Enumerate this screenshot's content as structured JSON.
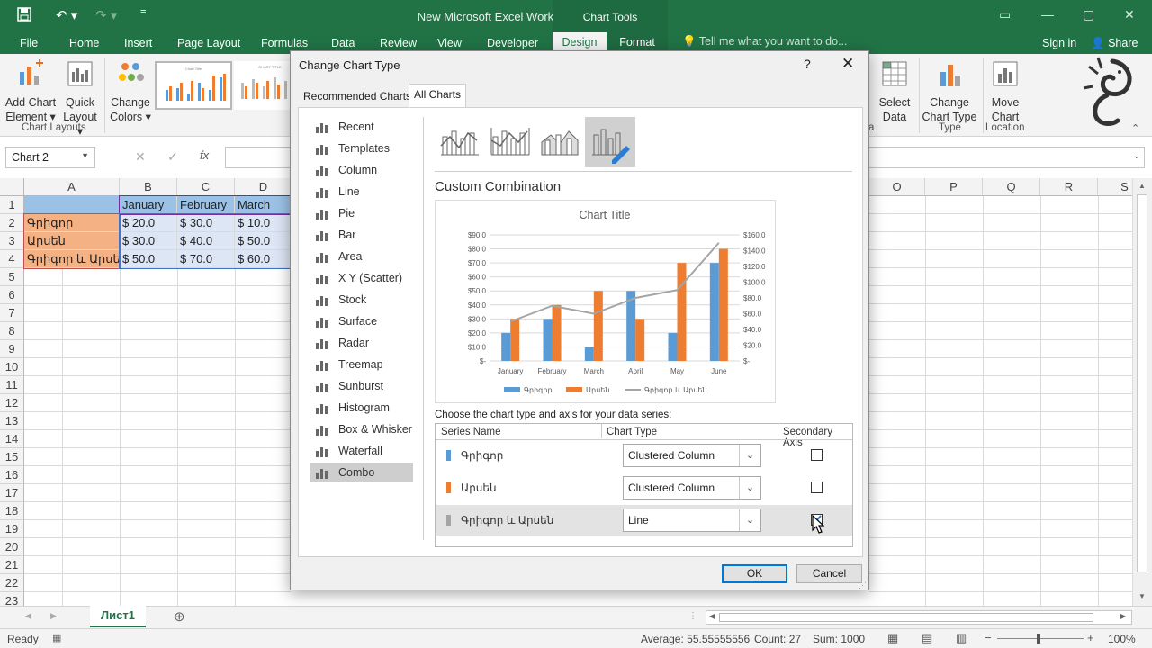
{
  "titlebar": {
    "file_title": "New Microsoft Excel Worksheet.xlsx - Excel",
    "context_label": "Chart Tools"
  },
  "tabs": [
    "File",
    "Home",
    "Insert",
    "Page Layout",
    "Formulas",
    "Data",
    "Review",
    "View",
    "Developer",
    "Design",
    "Format"
  ],
  "tellme": "Tell me what you want to do...",
  "signin": "Sign in",
  "share": "Share",
  "ribbon": {
    "add_chart_element": [
      "Add Chart",
      "Element"
    ],
    "quick_layout": [
      "Quick",
      "Layout"
    ],
    "change_colors": [
      "Change",
      "Colors"
    ],
    "chart_layouts_label": "Chart Layouts",
    "select_data": [
      "Select",
      "Data"
    ],
    "change_chart_type": [
      "Change",
      "Chart Type"
    ],
    "move_chart": [
      "Move",
      "Chart"
    ],
    "type_label": "Type",
    "location_label": "Location",
    "data_label_partial": "a"
  },
  "namebox": "Chart 2",
  "fx": "fx",
  "columns": [
    "A",
    "B",
    "C",
    "D",
    "O",
    "P",
    "Q",
    "R",
    "S"
  ],
  "rows": [
    "1",
    "2",
    "3",
    "4",
    "5",
    "6",
    "7",
    "8",
    "9",
    "10",
    "11",
    "12",
    "13",
    "14",
    "15",
    "16",
    "17",
    "18",
    "19",
    "20",
    "21",
    "22",
    "23"
  ],
  "cells": {
    "b1": "January",
    "c1": "February",
    "d1": "March",
    "a2": "Գրիգոր",
    "a3": "Արսեն",
    "a4": "Գրիգոր և Արսեն",
    "b2": "$    20.0",
    "c2": "$    30.0",
    "d2": "$    10.0",
    "b3": "$    30.0",
    "c3": "$    40.0",
    "d3": "$    50.0",
    "b4": "$    50.0",
    "c4": "$    70.0",
    "d4": "$    60.0"
  },
  "sheet_tab": "Лист1",
  "status": {
    "ready": "Ready",
    "average": "Average: 55.55555556",
    "count": "Count: 27",
    "sum": "Sum: 1000",
    "zoom": "100%"
  },
  "dialog": {
    "title": "Change Chart Type",
    "help": "?",
    "close": "✕",
    "tabs": [
      "Recommended Charts",
      "All Charts"
    ],
    "categories": [
      "Recent",
      "Templates",
      "Column",
      "Line",
      "Pie",
      "Bar",
      "Area",
      "X Y (Scatter)",
      "Stock",
      "Surface",
      "Radar",
      "Treemap",
      "Sunburst",
      "Histogram",
      "Box & Whisker",
      "Waterfall",
      "Combo"
    ],
    "selected_category": "Combo",
    "section_title": "Custom Combination",
    "choose_text": "Choose the chart type and axis for your data series:",
    "table_headers": [
      "Series Name",
      "Chart Type",
      "Secondary Axis"
    ],
    "series": [
      {
        "name": "Գրիգոր",
        "type": "Clustered Column",
        "secondary": false,
        "color": "#5b9bd5"
      },
      {
        "name": "Արսեն",
        "type": "Clustered Column",
        "secondary": false,
        "color": "#ed7d31"
      },
      {
        "name": "Գրիգոր և Արսեն",
        "type": "Line",
        "secondary": true,
        "color": "#a5a5a5"
      }
    ],
    "ok": "OK",
    "cancel": "Cancel"
  },
  "chart_data": {
    "type": "bar",
    "title": "Chart Title",
    "categories": [
      "January",
      "February",
      "March",
      "April",
      "May",
      "June"
    ],
    "series": [
      {
        "name": "Գրիգոր",
        "kind": "column",
        "axis": "primary",
        "color": "#5b9bd5",
        "values": [
          20,
          30,
          10,
          50,
          20,
          70
        ]
      },
      {
        "name": "Արսեն",
        "kind": "column",
        "axis": "primary",
        "color": "#ed7d31",
        "values": [
          30,
          40,
          50,
          30,
          70,
          80
        ]
      },
      {
        "name": "Գրիգոր և Արսեն",
        "kind": "line",
        "axis": "secondary",
        "color": "#a5a5a5",
        "values": [
          50,
          70,
          60,
          80,
          90,
          150
        ]
      }
    ],
    "y_ticks": [
      "$-",
      "$10.0",
      "$20.0",
      "$30.0",
      "$40.0",
      "$50.0",
      "$60.0",
      "$70.0",
      "$80.0",
      "$90.0"
    ],
    "y2_ticks": [
      "$-",
      "$20.0",
      "$40.0",
      "$60.0",
      "$80.0",
      "$100.0",
      "$120.0",
      "$140.0",
      "$160.0"
    ],
    "ylim": [
      0,
      90
    ],
    "y2lim": [
      0,
      160
    ],
    "legend": "bottom",
    "grid": true
  }
}
